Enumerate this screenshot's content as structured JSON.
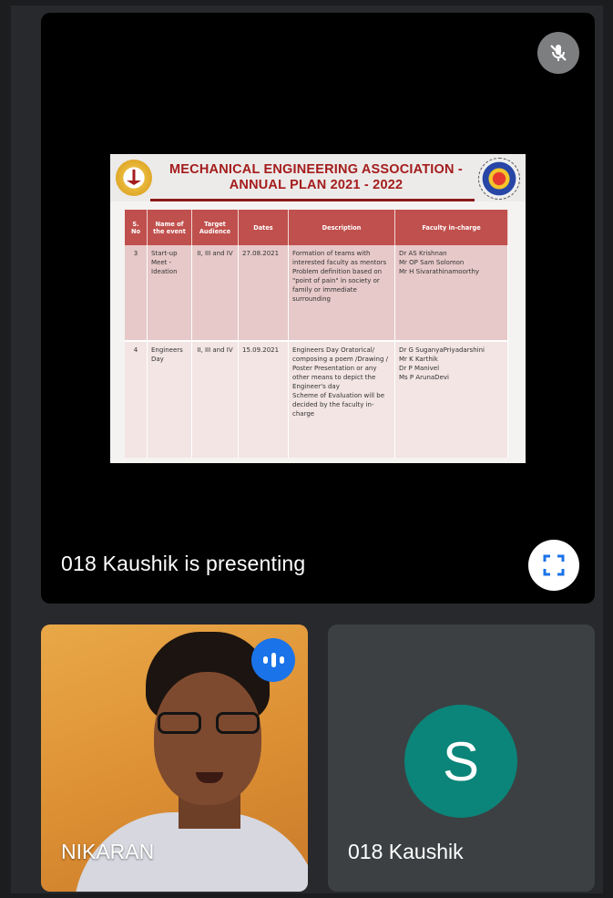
{
  "presentation": {
    "presenting_label": "018 Kaushik is presenting",
    "mic_icon": "mic-off-icon",
    "fullscreen_icon": "fullscreen-icon",
    "slide": {
      "title_line1": "MECHANICAL ENGINEERING ASSOCIATION -",
      "title_line2": "ANNUAL PLAN 2021 - 2022",
      "table": {
        "headers": [
          "S. No",
          "Name of the event",
          "Target Audience",
          "Dates",
          "Description",
          "Faculty in-charge"
        ],
        "rows": [
          {
            "sno": "3",
            "event": "Start-up Meet - Ideation",
            "audience": "II, III and IV",
            "dates": "27.08.2021",
            "description": "Formation of teams with interested faculty as mentors\nProblem definition based on \"point of pain\" in society or family or immediate surrounding",
            "faculty": "Dr AS Krishnan\nMr OP Sam Solomon\nMr H Sivarathinamoorthy"
          },
          {
            "sno": "4",
            "event": "Engineers Day",
            "audience": "II, III and IV",
            "dates": "15.09.2021",
            "description": "Engineers Day Oratorical/ composing a poem /Drawing / Poster Presentation or any other means to depict the Engineer's day\nScheme of Evaluation will be decided by the faculty in-charge",
            "faculty": "Dr G SuganyaPriyadarshini\nMr K Karthik\nDr P Manivel\nMs P ArunaDevi"
          }
        ]
      }
    }
  },
  "participants": [
    {
      "name": "NIKARAN",
      "speaking": true,
      "speaking_icon": "audio-level-icon"
    },
    {
      "name": "018 Kaushik",
      "avatar_letter": "S",
      "avatar_color": "#0b8579"
    }
  ],
  "colors": {
    "background": "#1c1d1f",
    "tile": "#3c4043",
    "accent_blue": "#1a73e8",
    "table_header": "#c0504d",
    "title_red": "#a41c1c"
  }
}
